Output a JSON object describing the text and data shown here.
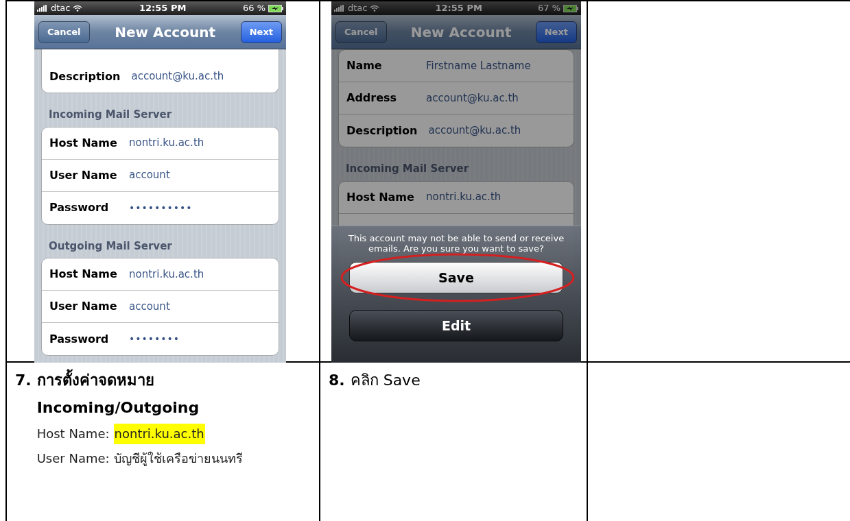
{
  "phones": [
    {
      "dimmed": false,
      "status": {
        "carrier": "dtac",
        "time": "12:55 PM",
        "battery": "66 %"
      },
      "nav": {
        "cancel": "Cancel",
        "title": "New Account",
        "next": "Next"
      },
      "sections": [
        {
          "kind": "group",
          "continued": true,
          "rows": [
            {
              "kind": "text",
              "label": "Description",
              "value": "account@ku.ac.th"
            }
          ]
        },
        {
          "kind": "header",
          "text": "Incoming Mail Server"
        },
        {
          "kind": "group",
          "continued": false,
          "rows": [
            {
              "kind": "text",
              "label": "Host Name",
              "value": "nontri.ku.ac.th"
            },
            {
              "kind": "text",
              "label": "User Name",
              "value": "account"
            },
            {
              "kind": "password",
              "label": "Password",
              "value": "••••••••••"
            }
          ]
        },
        {
          "kind": "header",
          "text": "Outgoing Mail Server"
        },
        {
          "kind": "group",
          "continued": false,
          "rows": [
            {
              "kind": "text",
              "label": "Host Name",
              "value": "nontri.ku.ac.th"
            },
            {
              "kind": "text",
              "label": "User Name",
              "value": "account"
            },
            {
              "kind": "password",
              "label": "Password",
              "value": "••••••••"
            }
          ]
        }
      ]
    },
    {
      "dimmed": true,
      "status": {
        "carrier": "dtac",
        "time": "12:55 PM",
        "battery": "67 %"
      },
      "nav": {
        "cancel": "Cancel",
        "title": "New Account",
        "next": "Next"
      },
      "sections": [
        {
          "kind": "group",
          "continued": false,
          "rows": [
            {
              "kind": "text",
              "label": "Name",
              "value": "Firstname Lastname"
            },
            {
              "kind": "text",
              "label": "Address",
              "value": "account@ku.ac.th"
            },
            {
              "kind": "text",
              "label": "Description",
              "value": "account@ku.ac.th"
            }
          ]
        },
        {
          "kind": "header",
          "text": "Incoming Mail Server"
        },
        {
          "kind": "group",
          "continued": false,
          "rows": [
            {
              "kind": "text",
              "label": "Host Name",
              "value": "nontri.ku.ac.th"
            },
            {
              "kind": "hidden"
            },
            {
              "kind": "hidden"
            }
          ]
        }
      ],
      "alert": {
        "message": "This account may not be able to send or receive emails. Are you sure you want to save?",
        "buttons": [
          {
            "label": "Save",
            "kind": "light",
            "circled": true
          },
          {
            "label": "Edit",
            "kind": "dark",
            "circled": false
          }
        ]
      }
    }
  ],
  "steps": [
    {
      "number": "7.",
      "title": [
        "การตั้งค่าจดหมาย",
        "Incoming/Outgoing"
      ],
      "details": [
        {
          "label": "Host Name:",
          "value": "nontri.ku.ac.th",
          "highlighted": true
        },
        {
          "label": "User Name:",
          "value": "บัญชีผู้ใช้เครือข่ายนนทรี",
          "highlighted": false
        }
      ]
    },
    {
      "number": "8.",
      "text": "คลิก Save"
    }
  ]
}
